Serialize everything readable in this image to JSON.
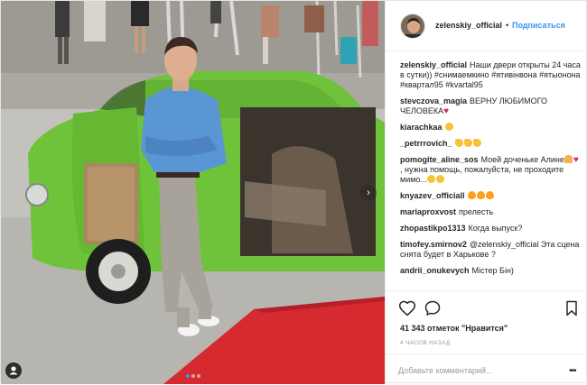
{
  "header": {
    "username": "zelenskiy_official",
    "separator": "•",
    "follow_label": "Подписаться"
  },
  "caption": {
    "username": "zelenskiy_official",
    "text": "Наши двери открыты 24 часа в сутки)) #снимаемкино #ятивінвона #ятыонона #квартал95 #kvartal95"
  },
  "comments": [
    {
      "username": "stevczova_magia",
      "text": "ВЕРНУ ЛЮБИМОГО ЧЕЛОВЕКА",
      "emoji": [
        "heart"
      ]
    },
    {
      "username": "kiarachkaa",
      "text": "",
      "emoji": [
        "smile"
      ]
    },
    {
      "username": "_petrrrovich_",
      "text": "",
      "emoji": [
        "hand",
        "hand",
        "hand"
      ]
    },
    {
      "username": "pomogite_aline_sos",
      "text": "Моей доченьке Алине",
      "text2": ", нужна помощь, пожалуйста, не проходите мимо...",
      "emoji_mid": [
        "girl",
        "heart"
      ],
      "emoji": [
        "smile",
        "smile"
      ]
    },
    {
      "username": "knyazev_officiall",
      "text": "",
      "emoji": [
        "fire",
        "fire",
        "fire"
      ]
    },
    {
      "username": "mariaproxvost",
      "text": "прелесть",
      "emoji": []
    },
    {
      "username": "zhopastikpo1313",
      "text": "Когда выпуск?",
      "emoji": []
    },
    {
      "username": "timofey.smirnov2",
      "text": "@zelenskiy_official Эта сцена снята будет в Харькове ?",
      "emoji": []
    },
    {
      "username": "andrii_onukevych",
      "text": "Містер Бін)",
      "emoji": []
    }
  ],
  "actions": {
    "likes_text": "41 343 отметок \"Нравится\"",
    "time_ago": "4 ЧАСОВ НАЗАД",
    "comment_placeholder": "Добавьте комментарий...",
    "more_label": "•••"
  },
  "media": {
    "next_arrow": "›",
    "carousel_count": 3,
    "carousel_active": 0
  },
  "colors": {
    "link": "#3897f0",
    "car": "#6fc33a",
    "carpet": "#d9262e",
    "shirt": "#5b96d4"
  },
  "icons": [
    "heart-icon",
    "comment-icon",
    "bookmark-icon",
    "more-icon",
    "next-arrow-icon",
    "user-tag-icon"
  ]
}
